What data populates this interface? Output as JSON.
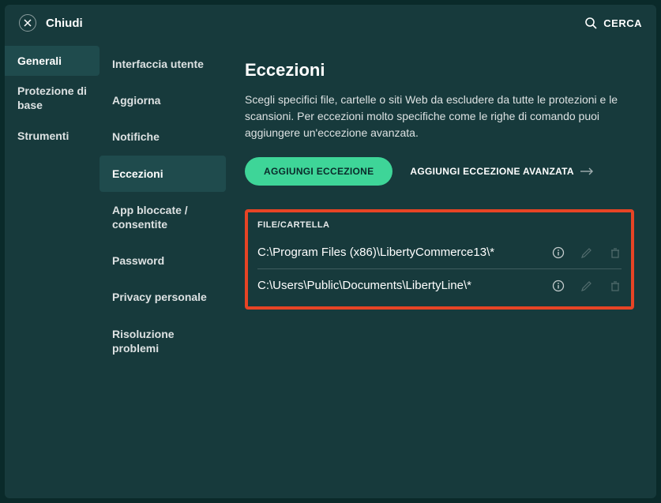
{
  "titlebar": {
    "close_label": "Chiudi",
    "search_label": "CERCA"
  },
  "sidebar_primary": {
    "items": [
      {
        "label": "Generali",
        "active": true
      },
      {
        "label": "Protezione di base",
        "active": false
      },
      {
        "label": "Strumenti",
        "active": false
      }
    ]
  },
  "sidebar_secondary": {
    "items": [
      {
        "label": "Interfaccia utente",
        "active": false
      },
      {
        "label": "Aggiorna",
        "active": false
      },
      {
        "label": "Notifiche",
        "active": false
      },
      {
        "label": "Eccezioni",
        "active": true
      },
      {
        "label": "App bloccate / consentite",
        "active": false
      },
      {
        "label": "Password",
        "active": false
      },
      {
        "label": "Privacy personale",
        "active": false
      },
      {
        "label": "Risoluzione problemi",
        "active": false
      }
    ]
  },
  "content": {
    "title": "Eccezioni",
    "description": "Scegli specifici file, cartelle o siti Web da escludere da tutte le protezioni e le scansioni. Per eccezioni molto specifiche come le righe di comando puoi aggiungere un'eccezione avanzata.",
    "add_button": "AGGIUNGI ECCEZIONE",
    "add_advanced": "AGGIUNGI ECCEZIONE AVANZATA",
    "list_header": "FILE/CARTELLA",
    "rows": [
      {
        "path": "C:\\Program Files (x86)\\LibertyCommerce13\\*"
      },
      {
        "path": "C:\\Users\\Public\\Documents\\LibertyLine\\*"
      }
    ]
  },
  "colors": {
    "accent": "#3ed598",
    "highlight_border": "#e74425",
    "background": "#173a3c"
  }
}
